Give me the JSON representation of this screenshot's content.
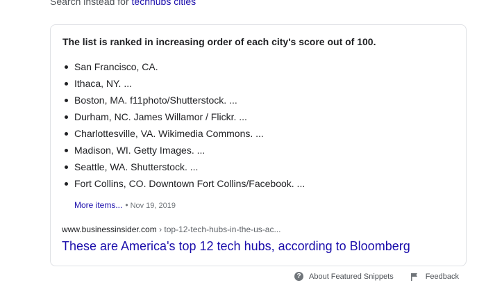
{
  "search_instead": {
    "prefix": "Search instead for",
    "query": "techhubs cities"
  },
  "snippet": {
    "heading": "The list is ranked in increasing order of each city's score out of 100.",
    "items": [
      "San Francisco, CA.",
      "Ithaca, NY. ...",
      "Boston, MA. f11photo/Shutterstock. ...",
      "Durham, NC. James Willamor / Flickr. ...",
      "Charlottesville, VA. Wikimedia Commons. ...",
      "Madison, WI. Getty Images. ...",
      "Seattle, WA. Shutterstock. ...",
      "Fort Collins, CO. Downtown Fort Collins/Facebook. ..."
    ],
    "more_items_label": "More items...",
    "separator": "•",
    "date": "Nov 19, 2019"
  },
  "source": {
    "domain": "www.businessinsider.com",
    "path": " › top-12-tech-hubs-in-the-us-ac..."
  },
  "result": {
    "title": "These are America's top 12 tech hubs, according to Bloomberg"
  },
  "footer": {
    "about_label": "About Featured Snippets",
    "feedback_label": "Feedback"
  },
  "icons": {
    "help": "question-circle-icon",
    "feedback": "flag-icon"
  },
  "colors": {
    "link": "#1a0dab",
    "text": "#202124",
    "muted": "#70757a",
    "border": "#dfe1e5"
  }
}
